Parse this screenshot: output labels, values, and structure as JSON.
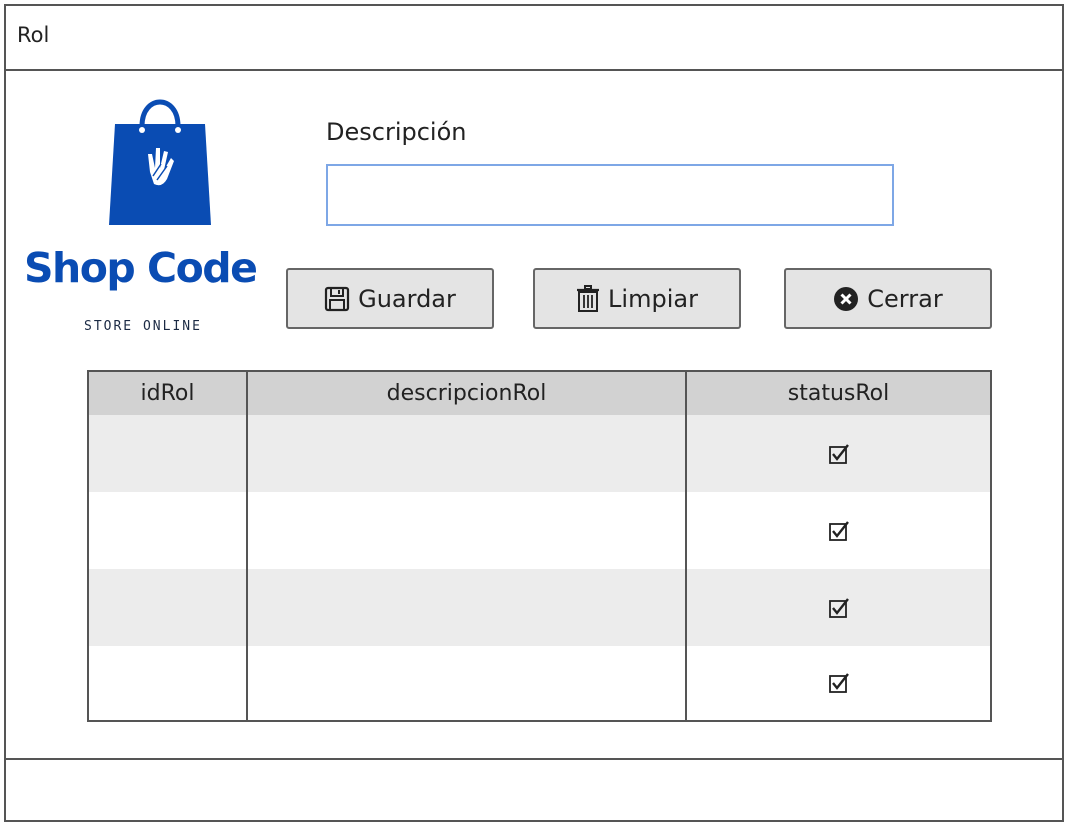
{
  "window": {
    "title": "Rol"
  },
  "logo": {
    "title": "Shop Code",
    "subtitle": "STORE ONLINE"
  },
  "form": {
    "label": "Descripción",
    "value": "",
    "placeholder": ""
  },
  "buttons": {
    "save": "Guardar",
    "clear": "Limpiar",
    "close": "Cerrar"
  },
  "table": {
    "columns": [
      "idRol",
      "descripcionRol",
      "statusRol"
    ],
    "rows": [
      {
        "idRol": "",
        "descripcionRol": "",
        "statusRol": true
      },
      {
        "idRol": "",
        "descripcionRol": "",
        "statusRol": true
      },
      {
        "idRol": "",
        "descripcionRol": "",
        "statusRol": true
      },
      {
        "idRol": "",
        "descripcionRol": "",
        "statusRol": true
      }
    ]
  },
  "colors": {
    "brand": "#0a4cb3",
    "input_border": "#7ea7e6",
    "button_bg": "#e4e4e4",
    "header_bg": "#d2d2d2",
    "alt_row": "#ececec"
  },
  "icons": {
    "save": "floppy-disk-icon",
    "clear": "trash-icon",
    "close": "close-circle-icon",
    "status": "checkbox-checked-icon",
    "logo": "shopping-bag-icon"
  }
}
